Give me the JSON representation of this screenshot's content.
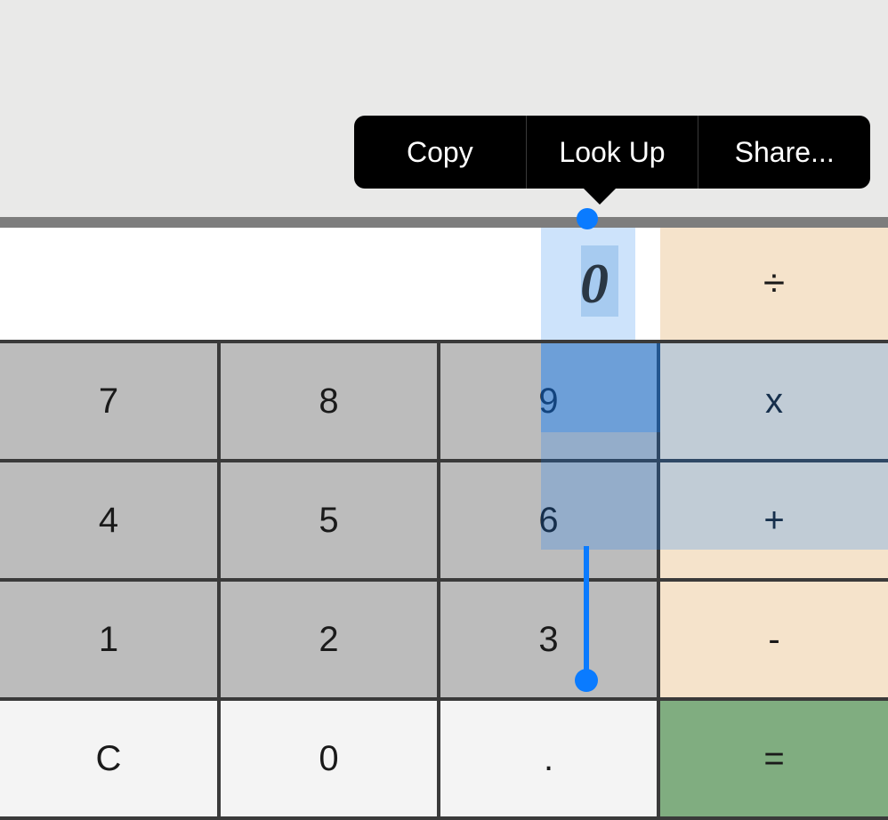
{
  "context_menu": {
    "items": [
      "Copy",
      "Look Up",
      "Share..."
    ]
  },
  "display": {
    "value": "0"
  },
  "operators": {
    "divide": "÷",
    "multiply": "x",
    "add": "+",
    "subtract": "-",
    "equals": "="
  },
  "keys": {
    "r1": [
      "7",
      "8",
      "9"
    ],
    "r2": [
      "4",
      "5",
      "6"
    ],
    "r3": [
      "1",
      "2",
      "3"
    ],
    "r4": [
      "C",
      "0",
      "."
    ]
  }
}
